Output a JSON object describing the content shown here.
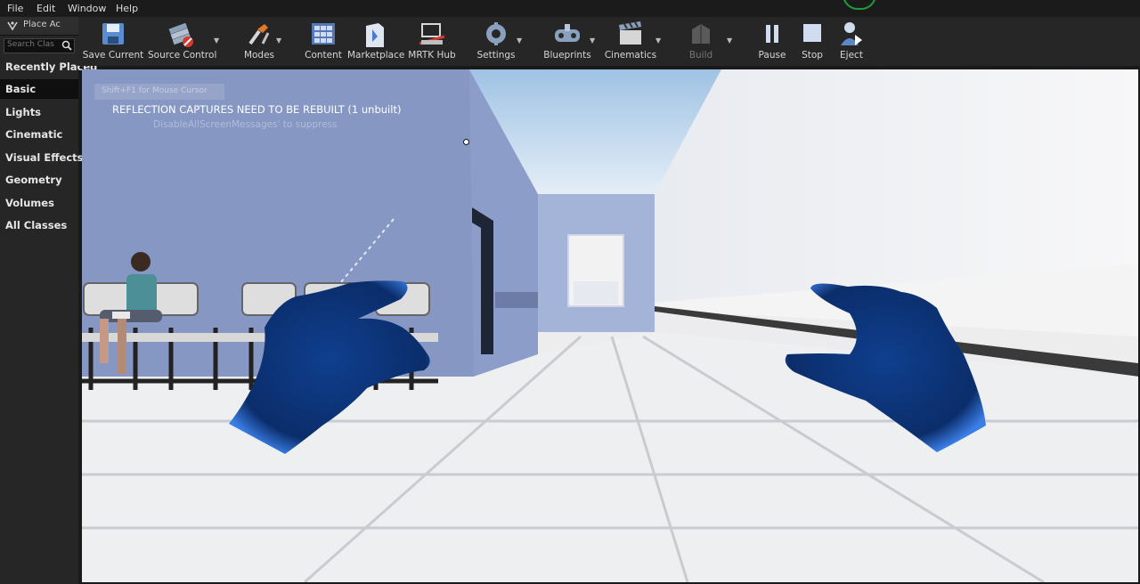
{
  "menu": [
    "File",
    "Edit",
    "Window",
    "Help"
  ],
  "panel": {
    "tab_label": "Place Ac",
    "search_placeholder": "Search Clas",
    "categories": [
      "Recently Placed",
      "Basic",
      "Lights",
      "Cinematic",
      "Visual Effects",
      "Geometry",
      "Volumes",
      "All Classes"
    ],
    "selected": "Basic"
  },
  "toolbar": {
    "save": "Save Current",
    "source_control": "Source Control",
    "modes": "Modes",
    "content": "Content",
    "marketplace": "Marketplace",
    "mrtk": "MRTK Hub",
    "settings": "Settings",
    "blueprints": "Blueprints",
    "cinematics": "Cinematics",
    "build": "Build",
    "pause": "Pause",
    "stop": "Stop",
    "eject": "Eject"
  },
  "viewport": {
    "hint": "Shift+F1 for Mouse Cursor",
    "warning": "REFLECTION CAPTURES NEED TO BE REBUILT (1 unbuilt)",
    "suppress": "DisableAllScreenMessages' to suppress"
  },
  "colors": {
    "accent_hand": "#0d3a86",
    "wall_left": "#8f9fcb",
    "panel_bg": "#262626"
  }
}
